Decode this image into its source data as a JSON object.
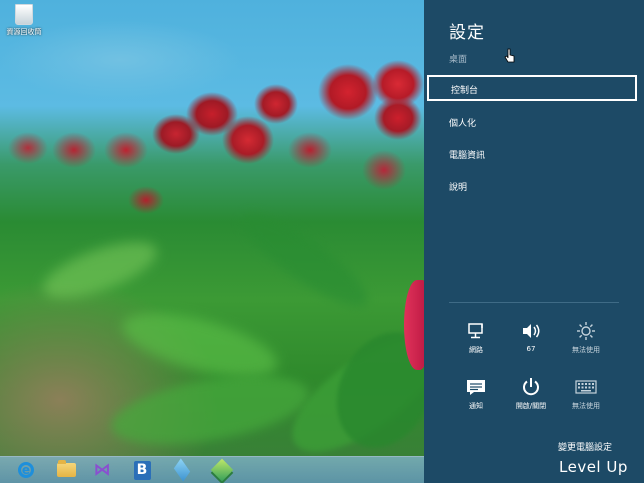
{
  "desktop": {
    "recycle_bin": {
      "label": "資源回收筒",
      "icon": "recycle-bin-icon"
    }
  },
  "taskbar": {
    "items": [
      {
        "name": "internet-explorer",
        "icon": "ie-icon",
        "glyph": "e"
      },
      {
        "name": "file-explorer",
        "icon": "folder-icon"
      },
      {
        "name": "visual-studio",
        "icon": "visual-studio-icon",
        "glyph": "⋈"
      },
      {
        "name": "blend",
        "icon": "b-app-icon",
        "glyph": "B"
      },
      {
        "name": "network-app",
        "icon": "network-app-icon"
      },
      {
        "name": "stack-app",
        "icon": "stack-app-icon"
      }
    ]
  },
  "settings_pane": {
    "title": "設定",
    "menu": [
      {
        "id": "desktop",
        "label": "桌面",
        "dimmed": true
      },
      {
        "id": "control_panel",
        "label": "控制台",
        "selected": true
      },
      {
        "id": "personalize",
        "label": "個人化"
      },
      {
        "id": "pc_info",
        "label": "電腦資訊"
      },
      {
        "id": "help",
        "label": "說明"
      }
    ],
    "quick_settings": [
      {
        "id": "network",
        "label": "網路",
        "icon": "network-icon"
      },
      {
        "id": "volume",
        "label": "67",
        "icon": "volume-icon"
      },
      {
        "id": "brightness",
        "label": "無法使用",
        "icon": "brightness-icon",
        "disabled": true
      },
      {
        "id": "notifications",
        "label": "通知",
        "icon": "notifications-icon"
      },
      {
        "id": "power",
        "label": "開啟/關閉",
        "icon": "power-icon"
      },
      {
        "id": "keyboard",
        "label": "無法使用",
        "icon": "keyboard-icon",
        "disabled": true
      }
    ],
    "change_pc_settings": "變更電腦設定"
  },
  "watermark": "Level Up",
  "colors": {
    "pane_background": "#1d4a66",
    "selection_border": "#ffffff",
    "dimmed_text": "#a9bccb"
  }
}
